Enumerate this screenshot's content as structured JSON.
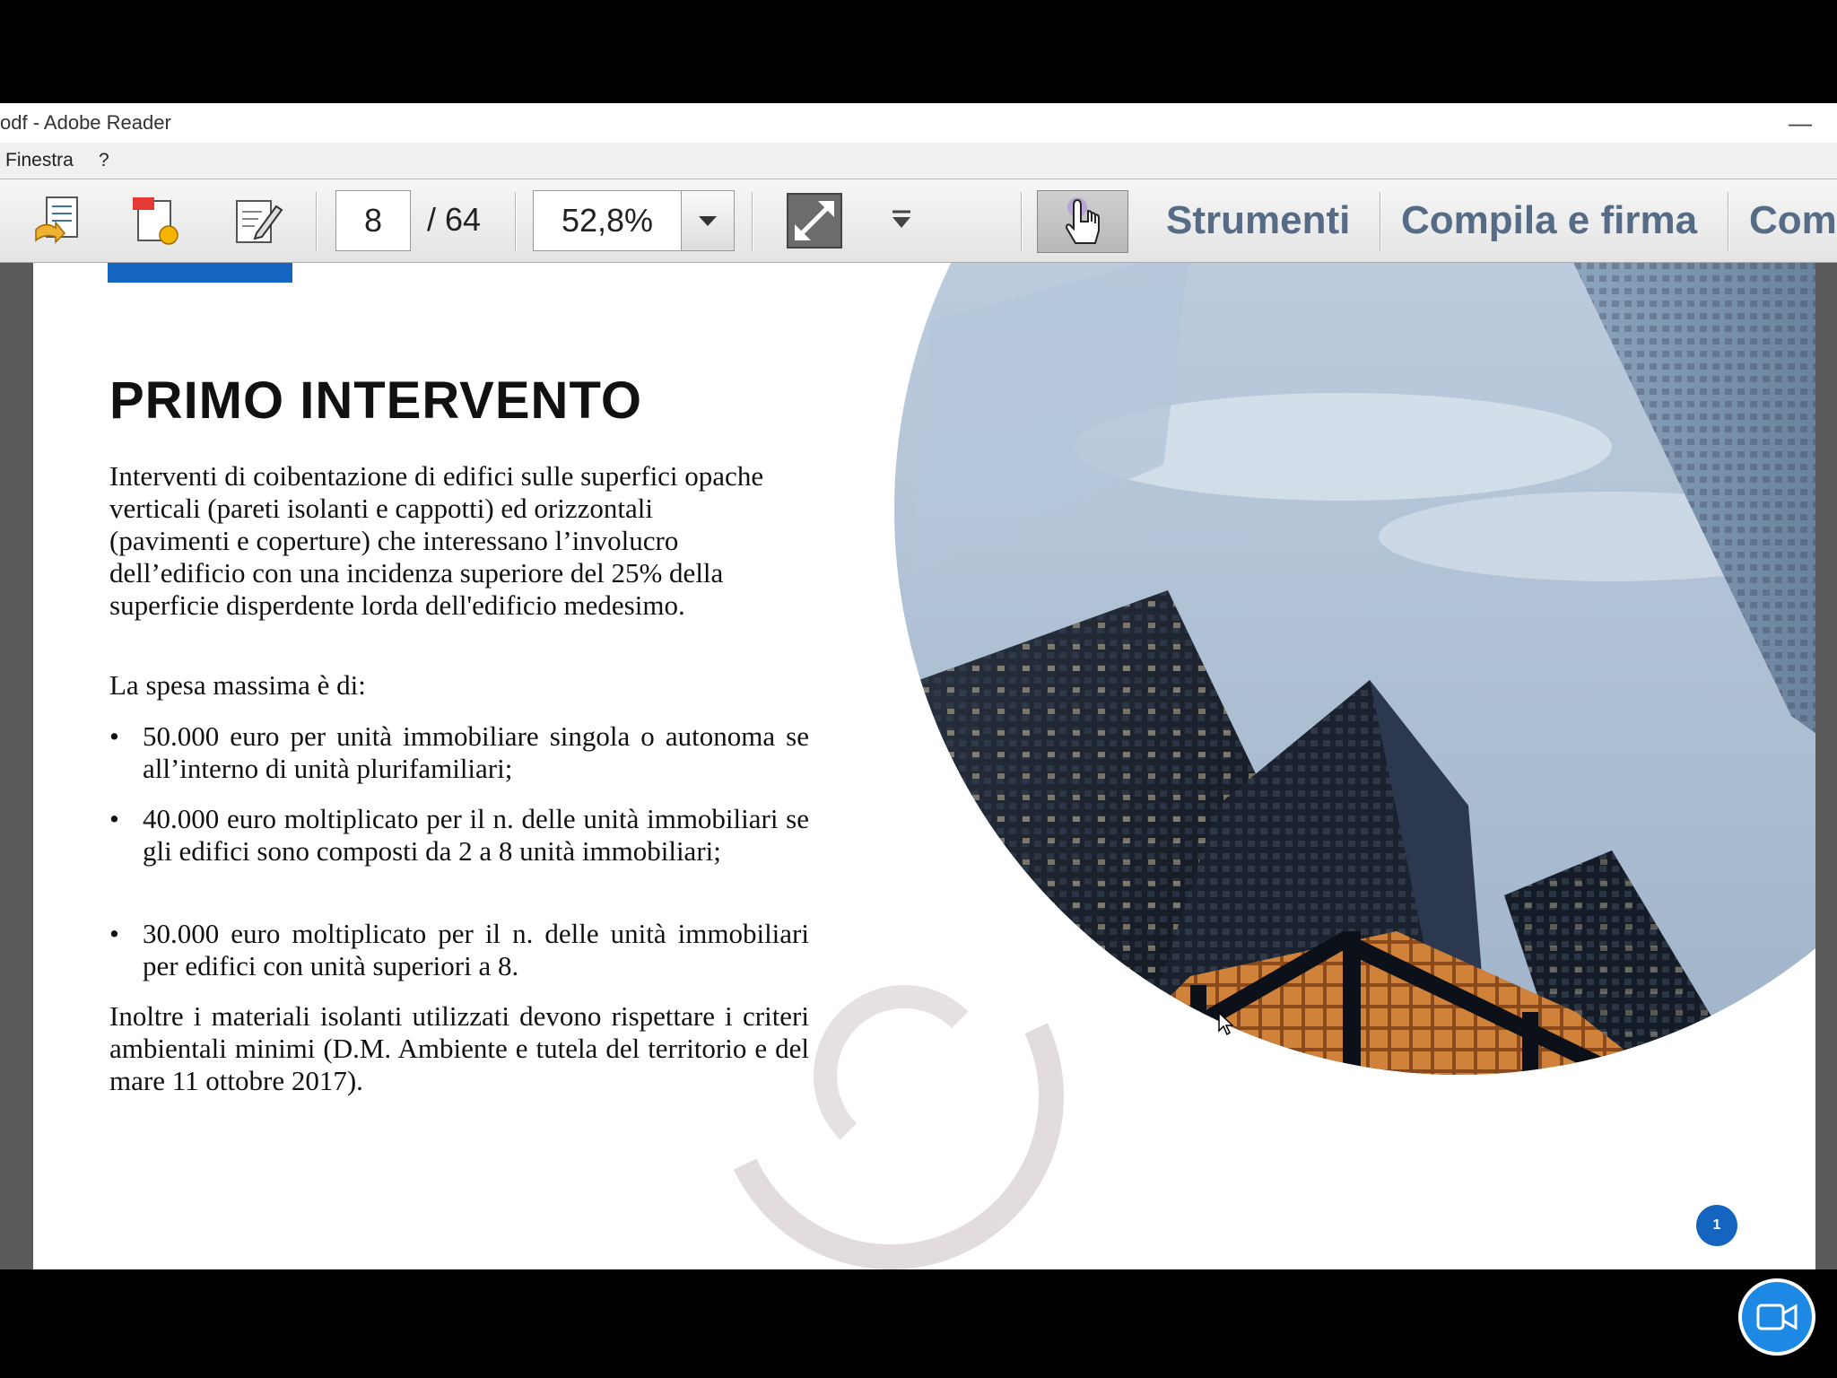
{
  "window": {
    "title": "odf - Adobe Reader",
    "minimize": "—"
  },
  "menu": {
    "items": [
      "Finestra",
      "?"
    ]
  },
  "toolbar": {
    "page_current": "8",
    "page_total": "/ 64",
    "zoom": "52,8%",
    "panels": [
      "Strumenti",
      "Compila e firma",
      "Com"
    ],
    "icons": [
      "open-icon",
      "create-pdf-icon",
      "edit-icon",
      "fit-page-icon",
      "dropdown-icon",
      "touch-hand-icon"
    ]
  },
  "slide": {
    "title": "PRIMO INTERVENTO",
    "intro": "Interventi di coibentazione di edifici sulle superfici opache verticali (pareti isolanti e cappotti) ed orizzontali (pavimenti e coperture) che interessano l’involucro dell’edificio con una incidenza superiore del 25% della  superficie disperdente lorda dell'edificio medesimo.",
    "spesa": "La spesa massima è di:",
    "bullets": [
      "50.000 euro per unità immobiliare singola o autonoma se all’interno di unità plurifamiliari;",
      "40.000 euro moltiplicato per il n. delle unità immobiliari se gli edifici sono composti da 2 a 8 unità immobiliari;",
      "30.000 euro moltiplicato per il n. delle unità immobiliari per edifici con unità superiori a 8."
    ],
    "outro": "Inoltre i materiali isolanti utilizzati devono rispettare i criteri ambientali minimi (D.M. Ambiente e tutela  del territorio e del mare 11 ottobre 2017).",
    "page_badge": "1"
  },
  "colors": {
    "accent": "#1565c0",
    "panel_text": "#566b85",
    "camera": "#1e88e5"
  }
}
